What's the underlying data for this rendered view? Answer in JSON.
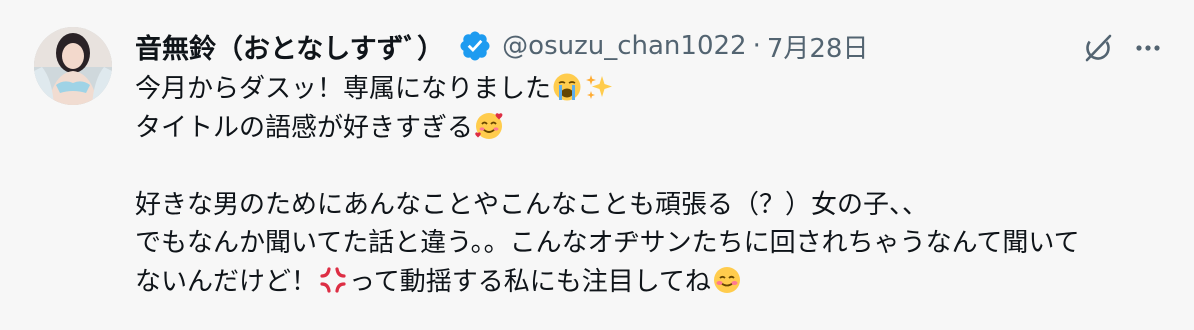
{
  "tweet": {
    "display_name": "音無鈴（おとなしすずﾞ）",
    "handle": "@osuzu_chan1022",
    "separator": "·",
    "date": "7月28日",
    "lines": [
      {
        "text": "今月からダスッ！専属になりました",
        "emojis_after": [
          "loudly-crying-face-emoji",
          "sparkles-emoji"
        ]
      },
      {
        "text": "タイトルの語感が好きすぎる",
        "emojis_after": [
          "smiling-face-with-hearts-emoji"
        ]
      },
      {
        "text": "",
        "emojis_after": []
      },
      {
        "text": "好きな男のためにあんなことやこんなことも頑張る（？）女の子、、",
        "emojis_after": []
      },
      {
        "text": "でもなんか聞いてた話と違う。。こんなオヂサンたちに回されちゃうなんて聞いて",
        "emojis_after": []
      },
      {
        "text_before": "ないんだけど！",
        "text_after": "って動揺する私にも注目してね",
        "emojis_mid": [
          "anger-symbol-emoji"
        ],
        "emojis_after": [
          "smiling-face-emoji"
        ]
      }
    ]
  },
  "icons": {
    "verified": "verified-badge-icon",
    "grok": "grok-icon",
    "more": "more-options-icon"
  },
  "colors": {
    "background": "#f7f7f7",
    "verified_blue": "#1d9bf0",
    "secondary_text": "#536471",
    "primary_text": "#0f1419"
  }
}
